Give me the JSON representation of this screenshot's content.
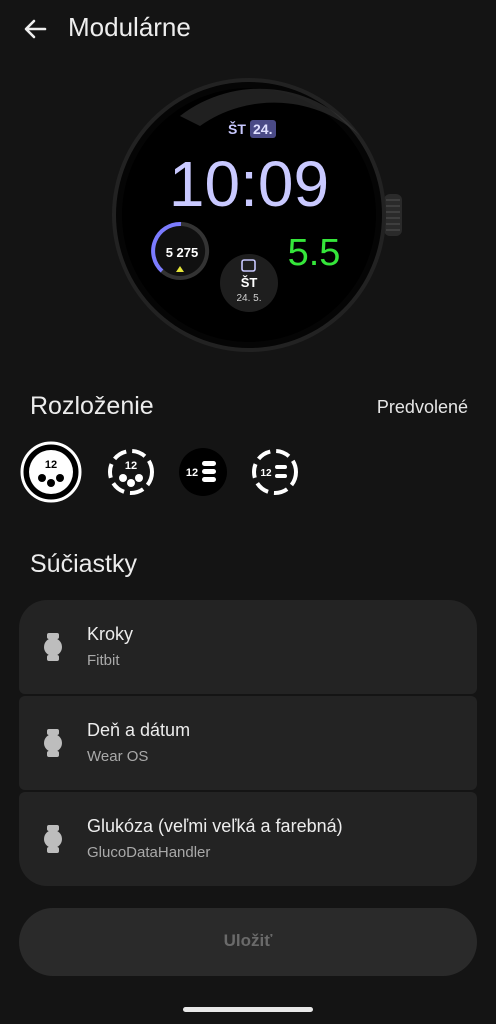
{
  "header": {
    "title": "Modulárne"
  },
  "watch_preview": {
    "day": "ŠT",
    "date": "24.",
    "time": "10:09",
    "steps": "5 275",
    "calendar_day": "ŠT",
    "calendar_date": "24. 5.",
    "glucose": "5.5",
    "colors": {
      "time": "#c9c9ff",
      "glucose": "#35e63a",
      "accent": "#7c7cff"
    }
  },
  "layout_section": {
    "title": "Rozloženie",
    "default_label": "Predvolené",
    "selected_index": 0,
    "option_glyph": "12"
  },
  "components_section": {
    "title": "Súčiastky",
    "items": [
      {
        "name": "Kroky",
        "source": "Fitbit"
      },
      {
        "name": "Deň a dátum",
        "source": "Wear OS"
      },
      {
        "name": "Glukóza (veľmi veľká a farebná)",
        "source": "GlucoDataHandler"
      }
    ]
  },
  "save_label": "Uložiť"
}
